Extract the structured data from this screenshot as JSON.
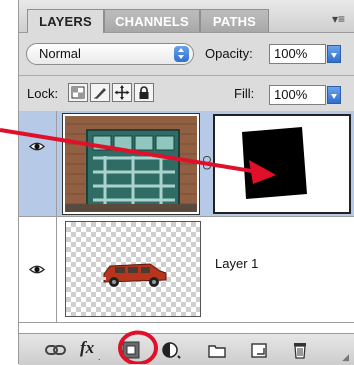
{
  "tabs": [
    {
      "label": "LAYERS",
      "active": true
    },
    {
      "label": "CHANNELS",
      "active": false
    },
    {
      "label": "PATHS",
      "active": false
    }
  ],
  "panel_menu_icon": "panel-menu-icon",
  "blend_mode": {
    "value": "Normal"
  },
  "opacity": {
    "label": "Opacity:",
    "value": "100%"
  },
  "lock": {
    "label": "Lock:",
    "buttons": [
      "lock-transparent-pixels-icon",
      "lock-image-pixels-icon",
      "lock-position-icon",
      "lock-all-icon"
    ]
  },
  "fill": {
    "label": "Fill:",
    "value": "100%"
  },
  "layers": [
    {
      "name": "",
      "selected": true,
      "visible": true,
      "has_mask": true
    },
    {
      "name": "Layer 1",
      "selected": false,
      "visible": true,
      "has_mask": false
    }
  ],
  "bottom_tools": [
    "link-layers-icon",
    "fx-icon",
    "add-layer-mask-icon",
    "adjustment-layer-icon",
    "new-group-icon",
    "new-layer-icon",
    "trash-icon"
  ],
  "fx_label": "fx",
  "annotation": {
    "arrow_color": "#e0102a",
    "circle_color": "#e0102a"
  }
}
